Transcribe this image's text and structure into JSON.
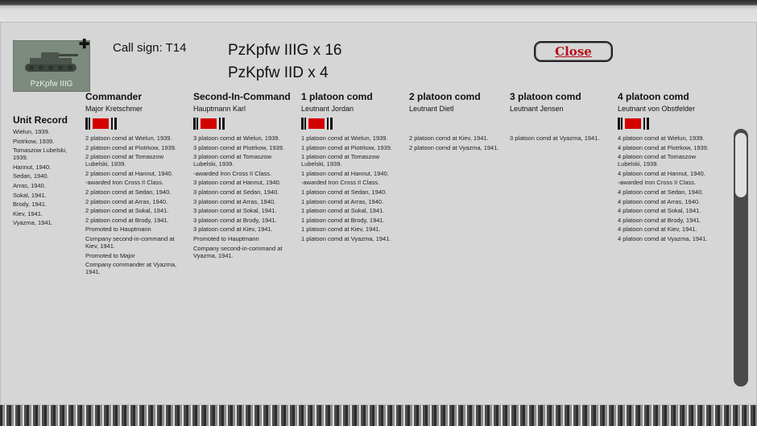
{
  "unit": {
    "image_label": "PzKpfw IIIG",
    "call_sign": "Call sign: T14",
    "tanks": [
      "PzKpfw IIIG x 16",
      "PzKpfw IID x 4"
    ]
  },
  "close_button": {
    "label": "Close",
    "color": "#b8101a"
  },
  "unit_record": {
    "title": "Unit Record",
    "entries": [
      "Wielun, 1939.",
      "Piotrkow, 1939.",
      "Tomaszow Lubelski, 1939.",
      "Hannut, 1940.",
      "Sedan, 1940.",
      "Arras, 1940.",
      "Sokal, 1941.",
      "Brody, 1941.",
      "Kiev, 1941.",
      "Vyazma, 1941."
    ]
  },
  "officers": [
    {
      "role": "Commander",
      "name": "Major Kretschmer",
      "medal": true,
      "entries": [
        "2 platoon comd at Wielun, 1939.",
        "2 platoon comd at Piotrkow, 1939.",
        "2 platoon comd at Tomaszow Lubelski, 1939.",
        "2 platoon comd at Hannut, 1940.",
        "-awarded Iron Cross II Class.",
        "2 platoon comd at Sedan, 1940.",
        "2 platoon comd at Arras, 1940.",
        "2 platoon comd at Sokal, 1941.",
        "2 platoon comd at Brody, 1941.",
        "Promoted to Hauptmann",
        "Company second-in-command at Kiev, 1941.",
        "Promoted to Major",
        "Company commander at Vyazma, 1941."
      ]
    },
    {
      "role": "Second-In-Command",
      "name": "Hauptmann Karl",
      "medal": true,
      "entries": [
        "3 platoon comd at Wielun, 1939.",
        "3 platoon comd at Piotrkow, 1939.",
        "3 platoon comd at Tomaszow Lubelski, 1939.",
        "-awarded Iron Cross II Class.",
        "3 platoon comd at Hannut, 1940.",
        "3 platoon comd at Sedan, 1940.",
        "3 platoon comd at Arras, 1940.",
        "3 platoon comd at Sokal, 1941.",
        "3 platoon comd at Brody, 1941.",
        "3 platoon comd at Kiev, 1941.",
        "Promoted to Hauptmann",
        "Company second-in-command at Vyazma, 1941."
      ]
    },
    {
      "role": "1 platoon comd",
      "name": "Leutnant Jordan",
      "medal": true,
      "entries": [
        "1 platoon comd at Wielun, 1939.",
        "1 platoon comd at Piotrkow, 1939.",
        "1 platoon comd at Tomaszow Lubelski, 1939.",
        "1 platoon comd at Hannut, 1940.",
        "-awarded Iron Cross II Class.",
        "1 platoon comd at Sedan, 1940.",
        "1 platoon comd at Arras, 1940.",
        "1 platoon comd at Sokal, 1941.",
        "1 platoon comd at Brody, 1941.",
        "1 platoon comd at Kiev, 1941.",
        "1 platoon comd at Vyazma, 1941."
      ]
    },
    {
      "role": "2 platoon comd",
      "name": "Leutnant Dietl",
      "medal": false,
      "entries": [
        "2 platoon comd at Kiev, 1941.",
        "2 platoon comd at Vyazma, 1941."
      ]
    },
    {
      "role": "3 platoon comd",
      "name": "Leutnant Jensen",
      "medal": false,
      "entries": [
        "3 platoon comd at Vyazma, 1941."
      ]
    },
    {
      "role": "4 platoon comd",
      "name": "Leutnant von Obstfelder",
      "medal": true,
      "entries": [
        "4 platoon comd at Wielun, 1939.",
        "4 platoon comd at Piotrkow, 1939.",
        "4 platoon comd at Tomaszow Lubelski, 1939.",
        "4 platoon comd at Hannut, 1940.",
        "-awarded Iron Cross II Class.",
        "4 platoon comd at Sedan, 1940.",
        "4 platoon comd at Arras, 1940.",
        "4 platoon comd at Sokal, 1941.",
        "4 platoon comd at Brody, 1941.",
        "4 platoon comd at Kiev, 1941.",
        "4 platoon comd at Vyazma, 1941."
      ]
    }
  ],
  "icons": {
    "tank": "tank-icon",
    "plus": "plus-icon",
    "medal": "iron-cross-ribbon-icon"
  },
  "colors": {
    "panel": "#d6d6d6",
    "ribbon_red": "#d40000",
    "close_text": "#b8101a"
  }
}
